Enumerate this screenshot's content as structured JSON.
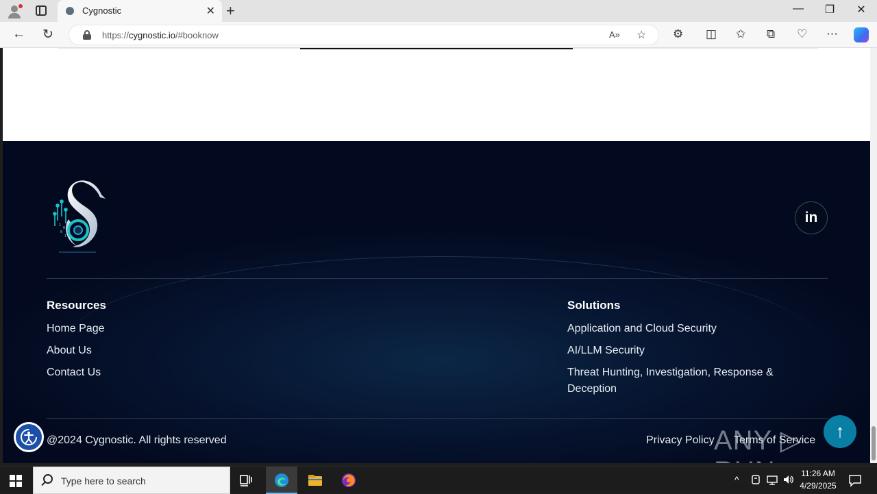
{
  "browser": {
    "tab_title": "Cygnostic",
    "url_prefix": "https://",
    "url_host": "cygnostic.io",
    "url_path": "/#booknow",
    "close_tab": "✕",
    "new_tab": "+",
    "minimize": "—",
    "restore": "❐",
    "close_window": "✕",
    "back": "←",
    "reload": "↻",
    "read_aloud": "A»",
    "favorite": "☆",
    "extensions": "⚙",
    "split_screen": "◫",
    "favorites_bar": "✩",
    "collections": "⧉",
    "performance": "♡",
    "more": "⋯"
  },
  "footer": {
    "social": {
      "linkedin": "in"
    },
    "resources": {
      "heading": "Resources",
      "links": [
        "Home Page",
        "About Us",
        "Contact Us"
      ]
    },
    "solutions": {
      "heading": "Solutions",
      "links": [
        "Application and Cloud Security",
        "AI/LLM Security",
        "Threat Hunting, Investigation, Response & Deception"
      ]
    },
    "copyright": "@2024 Cygnostic. All rights reserved",
    "legal": {
      "privacy": "Privacy Policy",
      "terms": "Terms of Service"
    },
    "to_top": "↑"
  },
  "watermark": {
    "text": "ANY ▷ RUN"
  },
  "taskbar": {
    "search_placeholder": "Type here to search",
    "time": "11:26 AM",
    "date": "4/29/2025",
    "tray_chevron": "^"
  },
  "colors": {
    "footer_bg": "#030a1f",
    "accent_teal": "#0a7fa6",
    "accessibility_blue": "#1c4fa8"
  }
}
